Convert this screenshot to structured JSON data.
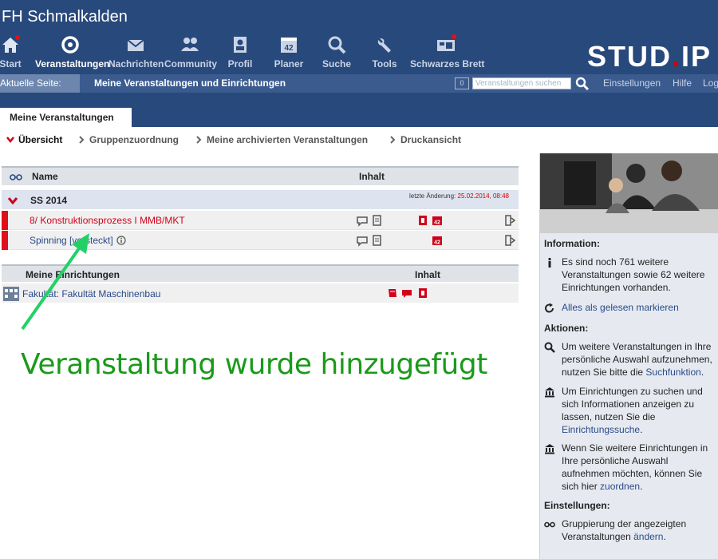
{
  "header": {
    "university": "FH Schmalkalden",
    "logo_text": "STUD",
    "logo_dot": ".",
    "logo_tail": "IP",
    "nav": [
      {
        "label": "Start",
        "icon": "home-icon"
      },
      {
        "label": "Veranstaltungen",
        "icon": "courses-icon",
        "active": true
      },
      {
        "label": "Nachrichten",
        "icon": "mail-icon"
      },
      {
        "label": "Community",
        "icon": "community-icon"
      },
      {
        "label": "Profil",
        "icon": "profile-icon"
      },
      {
        "label": "Planer",
        "icon": "calendar-icon"
      },
      {
        "label": "Suche",
        "icon": "search-icon"
      },
      {
        "label": "Tools",
        "icon": "tools-icon"
      },
      {
        "label": "Schwarzes Brett",
        "icon": "board-icon"
      }
    ]
  },
  "breadcrumb": {
    "label": "Aktuelle Seite:",
    "page": "Meine Veranstaltungen und Einrichtungen",
    "count": "0",
    "search_placeholder": "Veranstaltungen suchen",
    "links": [
      "Einstellungen",
      "Hilfe",
      "Logout"
    ]
  },
  "tabs": {
    "active": "Meine Veranstaltungen"
  },
  "subnav": [
    "Übersicht",
    "Gruppenzuordnung",
    "Meine archivierten Veranstaltungen",
    "Druckansicht"
  ],
  "courses_table": {
    "col_name": "Name",
    "col_content": "Inhalt",
    "semester": "SS 2014",
    "last_change_label": "letzte Änderung:",
    "last_change_date": "25.02.2014, 08:48",
    "courses": [
      {
        "name": "8/ Konstruktionsprozess I MMB/MKT",
        "status": "new"
      },
      {
        "name": "Spinning [versteckt]",
        "status": "hidden"
      }
    ]
  },
  "institutes_table": {
    "col_name": "Meine Einrichtungen",
    "col_content": "Inhalt",
    "rows": [
      {
        "name": "Fakultät: Fakultät Maschinenbau"
      }
    ]
  },
  "annotation": {
    "text": "Veranstaltung wurde hinzugefügt",
    "color": "#1a9a1a"
  },
  "sidebar": {
    "info_title": "Information:",
    "info_text": "Es sind noch 761 weitere Veranstaltungen sowie 62 weitere Einrichtungen vorhanden.",
    "mark_read": "Alles als gelesen markieren",
    "actions_title": "Aktionen:",
    "action1_text": "Um weitere Veranstaltungen in Ihre persönliche Auswahl aufzunehmen, nutzen Sie bitte die",
    "action1_link": "Suchfunktion",
    "action2_text": "Um Einrichtungen zu suchen und sich Informationen anzeigen zu lassen, nutzen Sie die",
    "action2_link": "Einrichtungssuche",
    "action3_text": "Wenn Sie weitere Einrichtungen in Ihre persönliche Auswahl aufnehmen möchten, können Sie sich hier",
    "action3_link": "zuordnen",
    "settings_title": "Einstellungen:",
    "settings_text": "Gruppierung der angezeigten Veranstaltungen",
    "settings_link": "ändern"
  },
  "colors": {
    "header_bg": "#28497c",
    "accent_red": "#d1001a",
    "link_blue": "#2a4a8a"
  }
}
